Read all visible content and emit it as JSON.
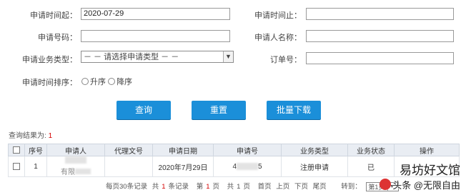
{
  "form": {
    "start_time_label": "申请时间起：",
    "start_time_value": "2020-07-29",
    "end_time_label": "申请时间止：",
    "end_time_value": "",
    "apply_no_label": "申请号码：",
    "apply_no_value": "",
    "applicant_label": "申请人名称：",
    "applicant_value": "",
    "biz_type_label": "申请业务类型：",
    "biz_type_selected": "－ － 请选择申请类型 － －",
    "order_no_label": "订单号：",
    "order_no_value": "",
    "sort_label": "申请时间排序：",
    "sort_asc": "升序",
    "sort_desc": "降序"
  },
  "buttons": {
    "query": "查询",
    "reset": "重置",
    "batch_download": "批量下载"
  },
  "result": {
    "label": "查询结果为:",
    "count": "1"
  },
  "table": {
    "headers": [
      "序号",
      "申请人",
      "代理文号",
      "申请日期",
      "申请号",
      "业务类型",
      "业务状态",
      "操作"
    ],
    "rows": [
      {
        "index": "1",
        "applicant": "有限",
        "agent_no": "",
        "date": "2020年7月29日",
        "apply_no_start": "4",
        "apply_no_end": "5",
        "biz_type": "注册申请",
        "status": "已",
        "action": ""
      }
    ]
  },
  "pager": {
    "per_page_pre": "每页30条记录",
    "total_pre": "共",
    "total": "1",
    "total_post": "条记录",
    "page_pre": "第",
    "page": "1",
    "page_post": "页",
    "pages_pre": "共",
    "pages": "1",
    "pages_post": "页",
    "first": "首页",
    "prev": "上页",
    "next": "下页",
    "last": "尾页",
    "goto_label": "转到：",
    "goto_selected": "第1页"
  },
  "watermark": "易坊好文馆",
  "watermark_sub": "头条 @无限自由"
}
